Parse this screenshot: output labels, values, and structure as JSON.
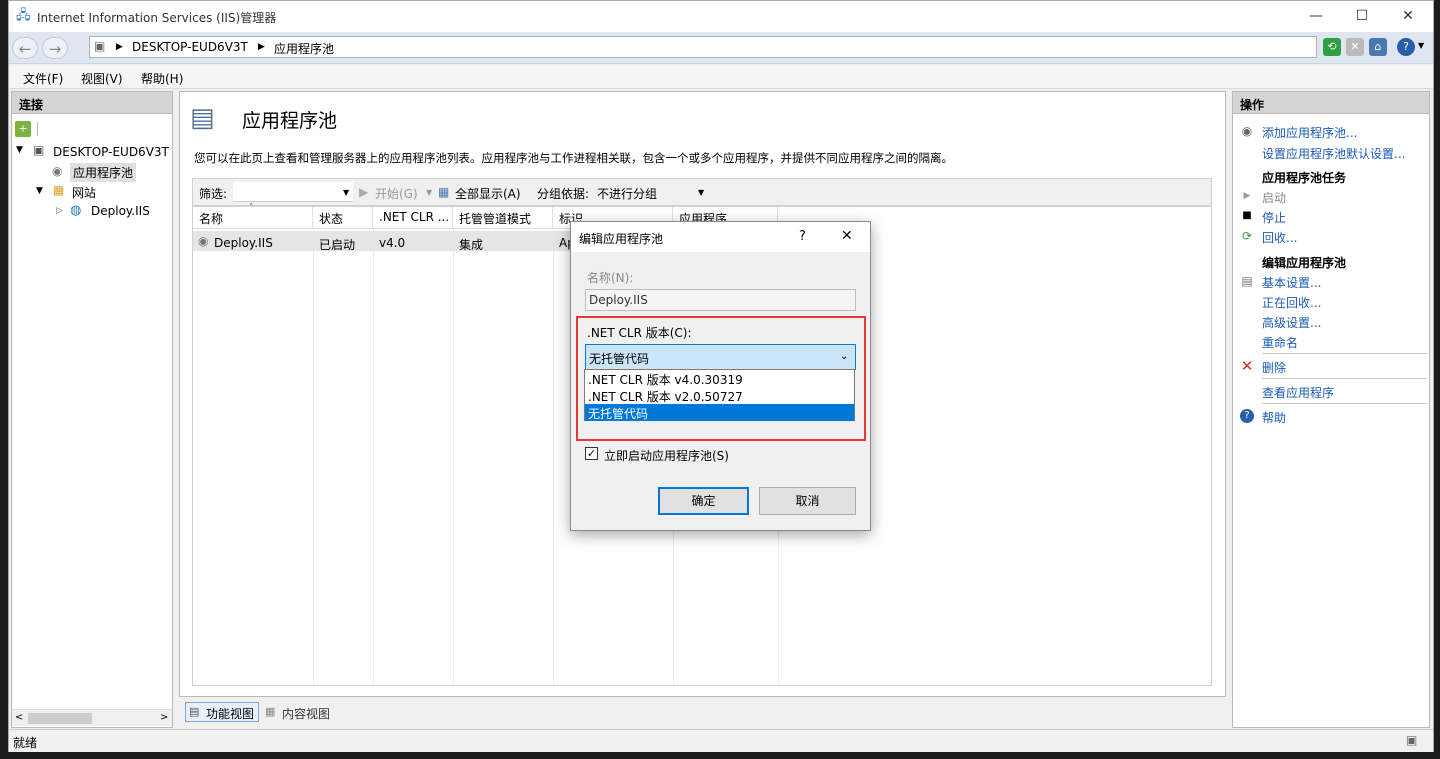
{
  "window": {
    "title": "Internet Information Services (IIS)管理器",
    "minimize": "—",
    "maximize": "☐",
    "close": "✕"
  },
  "address": {
    "path": [
      "DESKTOP-EUD6V3T",
      "应用程序池"
    ]
  },
  "menu": [
    "文件(F)",
    "视图(V)",
    "帮助(H)"
  ],
  "connections": {
    "header": "连接",
    "tree": {
      "server": "DESKTOP-EUD6V3T",
      "app_pools": "应用程序池",
      "sites": "网站",
      "site": "Deploy.IIS"
    }
  },
  "main": {
    "title": "应用程序池",
    "description": "您可以在此页上查看和管理服务器上的应用程序池列表。应用程序池与工作进程相关联，包含一个或多个应用程序，并提供不同应用程序之间的隔离。",
    "filter_label": "筛选:",
    "start_label": "开始(G)",
    "show_all_label": "全部显示(A)",
    "group_by_label": "分组依据:",
    "group_by_value": "不进行分组",
    "columns": [
      "名称",
      "状态",
      ".NET CLR ...",
      "托管管道模式",
      "标识",
      "应用程序"
    ],
    "rows": [
      {
        "name": "Deploy.IIS",
        "status": "已启动",
        "clr": "v4.0",
        "pipeline": "集成",
        "identity": "Ap"
      }
    ],
    "tabs": [
      "功能视图",
      "内容视图"
    ]
  },
  "actions": {
    "header": "操作",
    "add_pool": "添加应用程序池...",
    "set_defaults": "设置应用程序池默认设置...",
    "tasks_header": "应用程序池任务",
    "start": "启动",
    "stop": "停止",
    "recycle": "回收...",
    "edit_header": "编辑应用程序池",
    "basic_settings": "基本设置...",
    "recycling": "正在回收...",
    "advanced": "高级设置...",
    "rename": "重命名",
    "delete": "删除",
    "view_apps": "查看应用程序",
    "help": "帮助"
  },
  "status": {
    "text": "就绪"
  },
  "dialog": {
    "title": "编辑应用程序池",
    "help": "?",
    "close": "✕",
    "name_label": "名称(N):",
    "name_value": "Deploy.IIS",
    "clr_label": ".NET CLR 版本(C):",
    "clr_selected": "无托管代码",
    "clr_options": [
      ".NET CLR 版本 v4.0.30319",
      ".NET CLR 版本 v2.0.50727",
      "无托管代码"
    ],
    "autostart_label": "立即启动应用程序池(S)",
    "ok": "确定",
    "cancel": "取消"
  },
  "colors": {
    "accent": "#0078d7",
    "link": "#1a5bb5",
    "highlight_box": "#e53935"
  }
}
